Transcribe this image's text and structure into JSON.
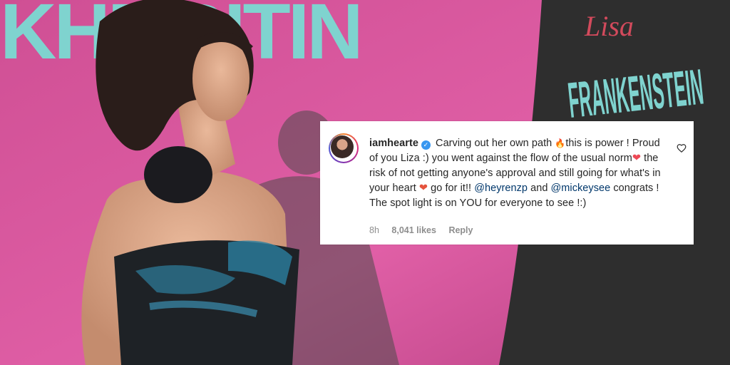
{
  "photo": {
    "sign_left": "KHMBITIN",
    "sign_right": "FRANKENSTEIN",
    "sign_script": "Lisa"
  },
  "comment": {
    "username": "iamhearte",
    "verified_icon": "verified-badge-icon",
    "text_1": " Carving out her own path ",
    "emoji_fire": "🔥",
    "text_2": "this is power ! Proud of you Liza :) you went against the flow of the usual norm",
    "emoji_heart": "❤",
    "text_3": " the risk of not getting anyone's approval and still going for what's in your heart ",
    "emoji_fire_heart": "❤",
    "text_4": " go for it!! ",
    "mention_1": "@heyrenzp",
    "text_5": " and ",
    "mention_2": "@mickeysee",
    "text_6": " congrats ! The spot light is on YOU for everyone to see !:)",
    "time": "8h",
    "likes": "8,041 likes",
    "reply": "Reply"
  },
  "colors": {
    "backdrop_pink": "#d8589a",
    "sign_teal": "#7fd3cf",
    "mention_blue": "#00376b",
    "verified_blue": "#3897f0"
  }
}
